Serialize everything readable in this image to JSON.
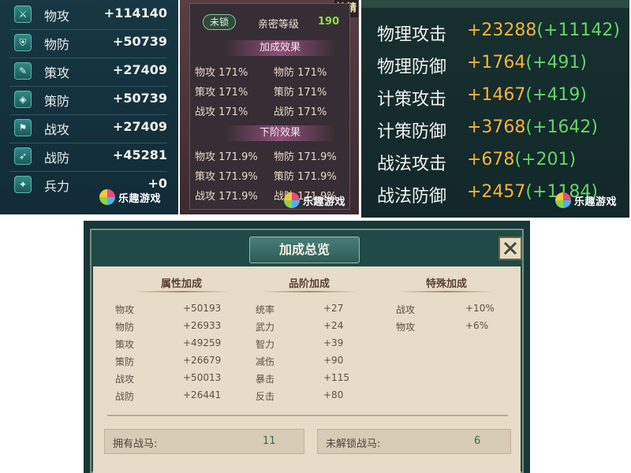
{
  "panel1": {
    "rows": [
      {
        "icon": "sword-icon",
        "label": "物攻",
        "value": "+114140"
      },
      {
        "icon": "armor-icon",
        "label": "物防",
        "value": "+50739"
      },
      {
        "icon": "scroll-icon",
        "label": "策攻",
        "value": "+27409"
      },
      {
        "icon": "shield-icon",
        "label": "策防",
        "value": "+50739"
      },
      {
        "icon": "flag-icon",
        "label": "战攻",
        "value": "+27409"
      },
      {
        "icon": "wing-icon",
        "label": "战防",
        "value": "+45281"
      },
      {
        "icon": "troops-icon",
        "label": "兵力",
        "value": "+0"
      }
    ]
  },
  "panel2": {
    "lock_label": "未锁",
    "intimacy_label": "亲密等级",
    "intimacy_value": "190",
    "badge": "炫精",
    "bonus_title": "加成效果",
    "bonus": [
      [
        "物攻 171%",
        "物防 171%"
      ],
      [
        "策攻 171%",
        "策防 171%"
      ],
      [
        "战攻 171%",
        "战防 171%"
      ]
    ],
    "next_title": "下阶效果",
    "next": [
      [
        "物攻 171.9%",
        "物防 171.9%"
      ],
      [
        "策攻 171.9%",
        "策防 171.9%"
      ],
      [
        "战攻 171.9%",
        "战防 171.9%"
      ]
    ]
  },
  "panel3": {
    "rows": [
      {
        "label": "物理攻击",
        "value": "+23288",
        "add": "(+11142)"
      },
      {
        "label": "物理防御",
        "value": "+1764",
        "add": "(+491)"
      },
      {
        "label": "计策攻击",
        "value": "+1467",
        "add": "(+419)"
      },
      {
        "label": "计策防御",
        "value": "+3768",
        "add": "(+1642)"
      },
      {
        "label": "战法攻击",
        "value": "+678",
        "add": "(+201)"
      },
      {
        "label": "战法防御",
        "value": "+2457",
        "add": "(+1184)"
      }
    ]
  },
  "panel4": {
    "title": "加成总览",
    "attr_head": "属性加成",
    "attr": [
      {
        "k": "物攻",
        "v": "+50193"
      },
      {
        "k": "物防",
        "v": "+26933"
      },
      {
        "k": "策攻",
        "v": "+49259"
      },
      {
        "k": "策防",
        "v": "+26679"
      },
      {
        "k": "战攻",
        "v": "+50013"
      },
      {
        "k": "战防",
        "v": "+26441"
      }
    ],
    "rank_head": "品阶加成",
    "rank": [
      {
        "k": "统率",
        "v": "+27"
      },
      {
        "k": "武力",
        "v": "+24"
      },
      {
        "k": "智力",
        "v": "+39"
      },
      {
        "k": "减伤",
        "v": "+90"
      },
      {
        "k": "暴击",
        "v": "+115"
      },
      {
        "k": "反击",
        "v": "+80"
      }
    ],
    "special_head": "特殊加成",
    "special": [
      {
        "k": "战攻",
        "v": "+10%"
      },
      {
        "k": "物攻",
        "v": "+6%"
      }
    ],
    "owned_label": "拥有战马:",
    "owned_value": "11",
    "unlocked_label": "未解锁战马:",
    "unlocked_value": "6"
  },
  "watermark": "乐趣游戏"
}
